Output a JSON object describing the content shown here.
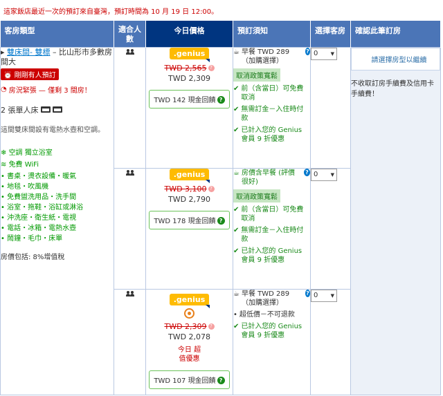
{
  "notice": "這家飯店最近一次的預訂來自臺灣，預訂時間為 10 月 19 日 12:00。",
  "headers": {
    "room_type": "客房類型",
    "people": "適合人數",
    "today_price": "今日價格",
    "policies": "預訂須知",
    "select_rooms": "選擇客房",
    "confirm": "確認此筆訂房"
  },
  "room": {
    "name_link": "雙床間- 雙標",
    "name_rest": " – 比山形市多數房間大",
    "just_booked": "剛剛有人預訂",
    "scarcity": "房況緊張 — 僅剩 3 間房！",
    "beds": "2 張單人床",
    "description": "這間雙床間設有電熱水壺和空調。",
    "facilities_top": "空調  獨立浴室",
    "wifi": "免費 WiFi",
    "facility_lines": [
      "書桌・燙衣設備・暖氣",
      "地毯・吹風機",
      "免費盥洗用品・洗手間",
      "浴室・拖鞋・浴缸或淋浴",
      "沖洗座・衛生紙・電視",
      "電話・冰箱・電熱水壺",
      "鬧鐘・毛巾・床單"
    ],
    "price_includes": "房價包括: 8%增值稅"
  },
  "offers": [
    {
      "genius": ".genius",
      "old_price": "TWD 2,565",
      "new_price": "TWD 2,309",
      "cashback": "TWD 142 現金回饋",
      "meal": "早餐 TWD 289 （加購選擇）",
      "cancel_badge": "取消政策寬鬆",
      "policies": [
        "前（含當日）可免費取消",
        "無需訂金－入住時付款",
        "已計入您的 Genius 會員 9 折優惠"
      ],
      "select": "0"
    },
    {
      "genius": ".genius",
      "old_price": "TWD 3,100",
      "new_price": "TWD 2,790",
      "cashback": "TWD 178 現金回饋",
      "meal": "房價含早餐 (評價很好)",
      "cancel_badge": "取消政策寬鬆",
      "policies": [
        "前（含當日）可免費取消",
        "無需訂金－入住時付款",
        "已計入您的 Genius 會員 9 折優惠"
      ],
      "select": "0"
    },
    {
      "genius": ".genius",
      "old_price": "TWD 2,309",
      "new_price": "TWD 2,078",
      "today_deal": "今日 超值優惠",
      "cashback": "TWD 107 現金回饋",
      "meal": "早餐 TWD 289 （加購選擇）",
      "dot_policy": "超低價－不可退款",
      "policies": [
        "已計入您的 Genius 會員 9 折優惠"
      ],
      "select": "0"
    }
  ],
  "confirm": {
    "button": "請選擇房型以繼續",
    "note": "不收取訂房手續費及信用卡手續費！"
  },
  "colors": {
    "header_blue": "#4b75b7",
    "price_header_navy": "#003580",
    "genius_yellow": "#febb02",
    "scarcity_red": "#cc0000",
    "policy_green": "#1a8a1a"
  }
}
